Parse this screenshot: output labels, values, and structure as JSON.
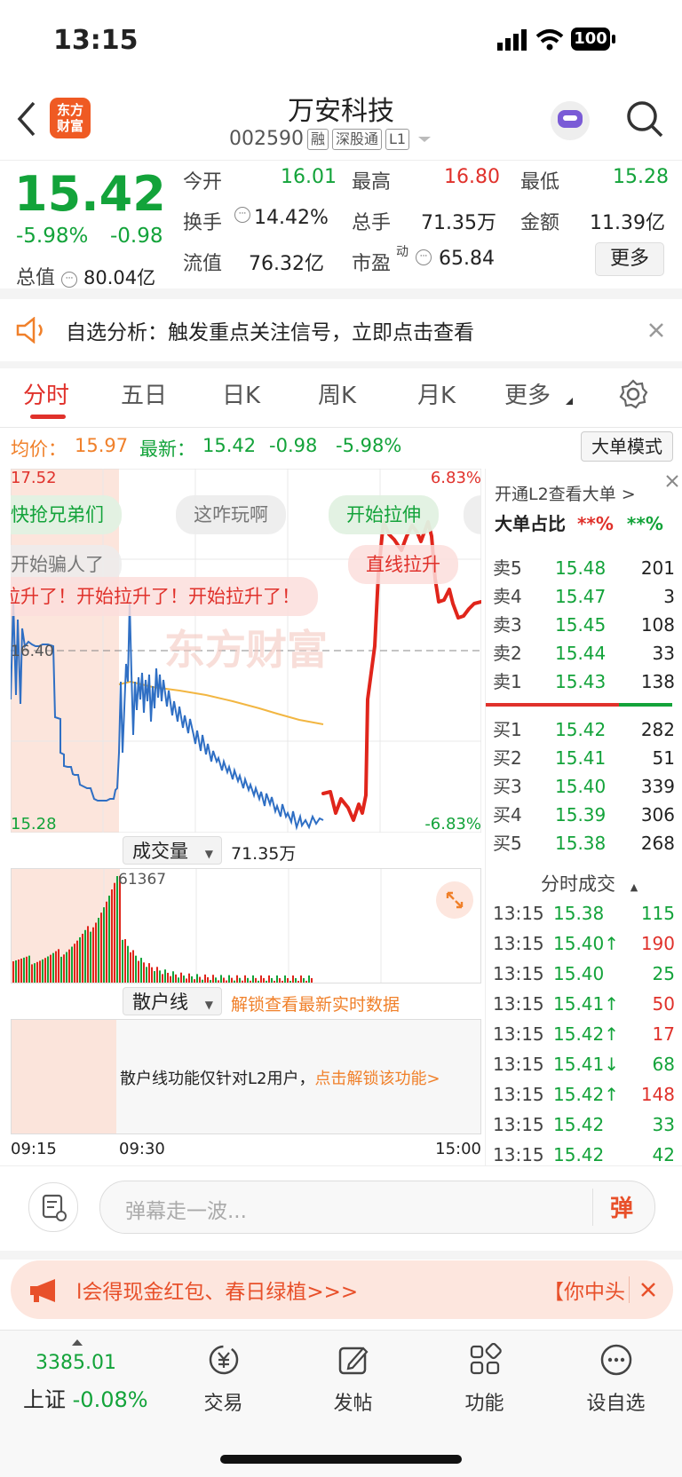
{
  "status_bar": {
    "time": "13:15",
    "battery": "100"
  },
  "header": {
    "stock_name": "万安科技",
    "stock_code": "002590",
    "tags": [
      "融",
      "深股通",
      "L1"
    ]
  },
  "quote": {
    "price": "15.42",
    "change_pct": "-5.98%",
    "change": "-0.98",
    "open_label": "今开",
    "open": "16.01",
    "high_label": "最高",
    "high": "16.80",
    "low_label": "最低",
    "low": "15.28",
    "turnover_label": "换手",
    "turnover": "14.42%",
    "volume_label": "总手",
    "volume": "71.35万",
    "amount_label": "金额",
    "amount": "11.39亿",
    "total_cap_label": "总值",
    "total_cap": "80.04亿",
    "float_cap_label": "流值",
    "float_cap": "76.32亿",
    "pe_label": "市盈",
    "pe_sup": "动",
    "pe": "65.84",
    "more_label": "更多"
  },
  "notice": {
    "text": "自选分析：触发重点关注信号，立即点击查看"
  },
  "tabs": [
    "分时",
    "五日",
    "日K",
    "周K",
    "月K",
    "更多"
  ],
  "avg_line": {
    "avg_label": "均价：",
    "avg": "15.97",
    "latest_label": "最新：",
    "latest": "15.42",
    "change": "-0.98",
    "change_pct": "-5.98%",
    "big_order_mode": "大单模式"
  },
  "chart": {
    "y_top": "17.52",
    "y_bottom": "15.28",
    "pct_top": "6.83%",
    "pct_bottom": "-6.83%",
    "mid": "16.40",
    "danmaku": [
      "快抢兄弟们",
      "这咋玩啊",
      "开始拉伸",
      "开始骗人了",
      "直线拉升",
      "拉升了！开始拉升了！开始拉升了！"
    ],
    "watermark": "东方财富"
  },
  "volume_panel": {
    "label": "成交量",
    "total": "71.35万",
    "max": "61367"
  },
  "retail_panel": {
    "label": "散户线",
    "unlock": "解锁查看最新实时数据",
    "note": "散户线功能仅针对L2用户，",
    "note_link": "点击解锁该功能>"
  },
  "x_axis": [
    "09:15",
    "09:30",
    "15:00"
  ],
  "order_book": {
    "l2_link": "开通L2查看大单 >",
    "ratio_label": "大单占比",
    "ratio_red": "**%",
    "ratio_green": "**%",
    "asks": [
      {
        "label": "卖5",
        "price": "15.48",
        "vol": "201"
      },
      {
        "label": "卖4",
        "price": "15.47",
        "vol": "3"
      },
      {
        "label": "卖3",
        "price": "15.45",
        "vol": "108"
      },
      {
        "label": "卖2",
        "price": "15.44",
        "vol": "33"
      },
      {
        "label": "卖1",
        "price": "15.43",
        "vol": "138"
      }
    ],
    "bids": [
      {
        "label": "买1",
        "price": "15.42",
        "vol": "282"
      },
      {
        "label": "买2",
        "price": "15.41",
        "vol": "51"
      },
      {
        "label": "买3",
        "price": "15.40",
        "vol": "339"
      },
      {
        "label": "买4",
        "price": "15.39",
        "vol": "306"
      },
      {
        "label": "买5",
        "price": "15.38",
        "vol": "268"
      }
    ]
  },
  "ticks": {
    "title": "分时成交",
    "rows": [
      {
        "time": "13:15",
        "price": "15.38",
        "vol": "115"
      },
      {
        "time": "13:15",
        "price": "15.40↑",
        "vol": "190"
      },
      {
        "time": "13:15",
        "price": "15.40",
        "vol": "25"
      },
      {
        "time": "13:15",
        "price": "15.41↑",
        "vol": "50"
      },
      {
        "time": "13:15",
        "price": "15.42↑",
        "vol": "17"
      },
      {
        "time": "13:15",
        "price": "15.41↓",
        "vol": "68"
      },
      {
        "time": "13:15",
        "price": "15.42↑",
        "vol": "148"
      },
      {
        "time": "13:15",
        "price": "15.42",
        "vol": "33"
      },
      {
        "time": "13:15",
        "price": "15.42",
        "vol": "42"
      }
    ]
  },
  "comment_bar": {
    "placeholder": "弹幕走一波...",
    "send_label": "弹"
  },
  "banner": {
    "text": "l会得现金红包、春日绿植>>>",
    "right_text": "【你中头"
  },
  "bottom_nav": {
    "index_value": "3385.01",
    "index_name": "上证",
    "index_change": "-0.08%",
    "items": [
      "交易",
      "发帖",
      "功能",
      "设自选"
    ]
  },
  "colors": {
    "up": "#e0312b",
    "down": "#13a33a",
    "accent": "#f0802a",
    "line": "#2f6fc4",
    "avg": "#f2b642"
  }
}
